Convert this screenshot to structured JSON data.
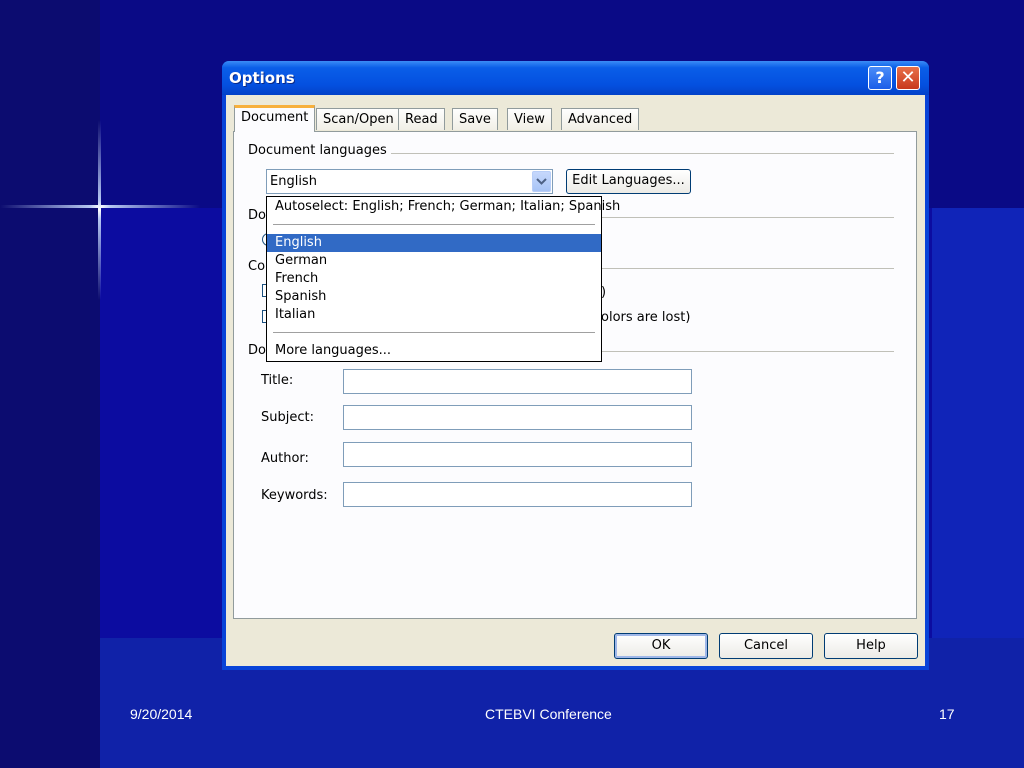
{
  "dialog": {
    "title": "Options",
    "help_button": "?",
    "close_button": "✕"
  },
  "tabs": [
    {
      "label": "Document"
    },
    {
      "label": "Scan/Open"
    },
    {
      "label": "Read"
    },
    {
      "label": "Save"
    },
    {
      "label": "View"
    },
    {
      "label": "Advanced"
    }
  ],
  "document_languages": {
    "group_label": "Document languages",
    "selected_value": "English",
    "edit_languages_label": "Edit Languages..."
  },
  "dropdown": {
    "autoselect": "Autoselect: English; French; German; Italian; Spanish",
    "options": [
      "English",
      "German",
      "French",
      "Spanish",
      "Italian"
    ],
    "selected": "English",
    "more": "More languages..."
  },
  "obscured": {
    "group2_label": "Do",
    "group3_label": "Co",
    "group4_label": "Do",
    "partial_text_1": ")",
    "partial_text_2": "olors are lost)"
  },
  "properties": {
    "title_label": "Title:",
    "subject_label": "Subject:",
    "author_label": "Author:",
    "keywords_label": "Keywords:"
  },
  "buttons": {
    "ok": "OK",
    "cancel": "Cancel",
    "help": "Help"
  },
  "footer": {
    "date": "9/20/2014",
    "center": "CTEBVI Conference",
    "page": "17"
  }
}
